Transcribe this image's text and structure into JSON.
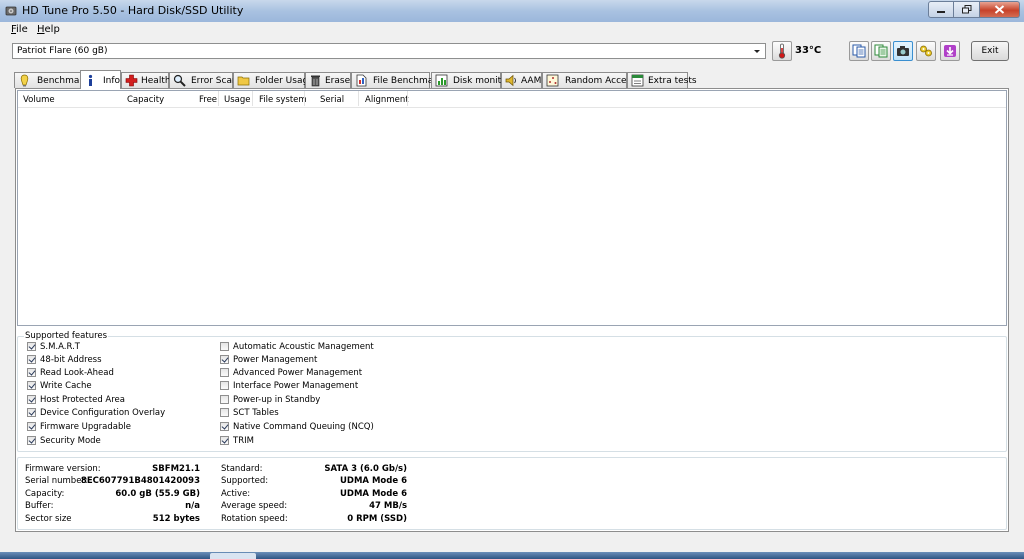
{
  "window": {
    "title": "HD Tune Pro 5.50 - Hard Disk/SSD Utility",
    "icon": "hd-tune-app-icon"
  },
  "menu": [
    {
      "label": "File",
      "accel": "F",
      "rest": "ile"
    },
    {
      "label": "Help",
      "accel": "H",
      "rest": "elp"
    }
  ],
  "toolbar": {
    "drive": "Patriot Flare (60 gB)",
    "temperature": "33°C",
    "exit_label": "Exit",
    "icons": [
      "copy-text-icon",
      "copy-info-icon",
      "screenshot-camera-icon",
      "options-keys-icon",
      "save-download-icon"
    ]
  },
  "tabs": [
    {
      "label": "Benchmark",
      "icon": "benchmark-icon"
    },
    {
      "label": "Info",
      "icon": "info-icon",
      "active": true
    },
    {
      "label": "Health",
      "icon": "health-cross-icon"
    },
    {
      "label": "Error Scan",
      "icon": "magnifier-icon"
    },
    {
      "label": "Folder Usage",
      "icon": "folder-icon"
    },
    {
      "label": "Erase",
      "icon": "trash-icon"
    },
    {
      "label": "File Benchmark",
      "icon": "file-benchmark-icon"
    },
    {
      "label": "Disk monitor",
      "icon": "disk-monitor-icon"
    },
    {
      "label": "AAM",
      "icon": "speaker-icon"
    },
    {
      "label": "Random Access",
      "icon": "random-access-icon"
    },
    {
      "label": "Extra tests",
      "icon": "extra-tests-icon"
    }
  ],
  "volumes": {
    "columns": [
      "Volume",
      "Capacity",
      "Free",
      "Usage",
      "File system",
      "Serial",
      "Alignment"
    ],
    "rows": []
  },
  "features": {
    "title": "Supported features",
    "left": [
      {
        "label": "S.M.A.R.T",
        "checked": true
      },
      {
        "label": "48-bit Address",
        "checked": true
      },
      {
        "label": "Read Look-Ahead",
        "checked": true
      },
      {
        "label": "Write Cache",
        "checked": true
      },
      {
        "label": "Host Protected Area",
        "checked": true
      },
      {
        "label": "Device Configuration Overlay",
        "checked": true
      },
      {
        "label": "Firmware Upgradable",
        "checked": true
      },
      {
        "label": "Security Mode",
        "checked": true
      }
    ],
    "right": [
      {
        "label": "Automatic Acoustic Management",
        "checked": false
      },
      {
        "label": "Power Management",
        "checked": true
      },
      {
        "label": "Advanced Power Management",
        "checked": false
      },
      {
        "label": "Interface Power Management",
        "checked": false
      },
      {
        "label": "Power-up in Standby",
        "checked": false
      },
      {
        "label": "SCT Tables",
        "checked": false
      },
      {
        "label": "Native Command Queuing (NCQ)",
        "checked": true
      },
      {
        "label": "TRIM",
        "checked": true
      }
    ]
  },
  "info": {
    "left": [
      {
        "label": "Firmware version:",
        "value": "SBFM21.1"
      },
      {
        "label": "Serial number:",
        "value": "8EC607791B4801420093"
      },
      {
        "label": "Capacity:",
        "value": "60.0 gB (55.9 GB)"
      },
      {
        "label": "Buffer:",
        "value": "n/a"
      },
      {
        "label": "Sector size",
        "value": "512 bytes"
      }
    ],
    "right": [
      {
        "label": "Standard:",
        "value": "SATA 3 (6.0 Gb/s)"
      },
      {
        "label": "Supported:",
        "value": "UDMA Mode 6"
      },
      {
        "label": "Active:",
        "value": "UDMA Mode 6"
      },
      {
        "label": "Average speed:",
        "value": "47 MB/s"
      },
      {
        "label": "Rotation speed:",
        "value": "0 RPM (SSD)"
      }
    ]
  },
  "colors": {
    "titlebar": "#a9c2e1",
    "close_button": "#c7432a",
    "panel_border": "#8d8d8d"
  }
}
